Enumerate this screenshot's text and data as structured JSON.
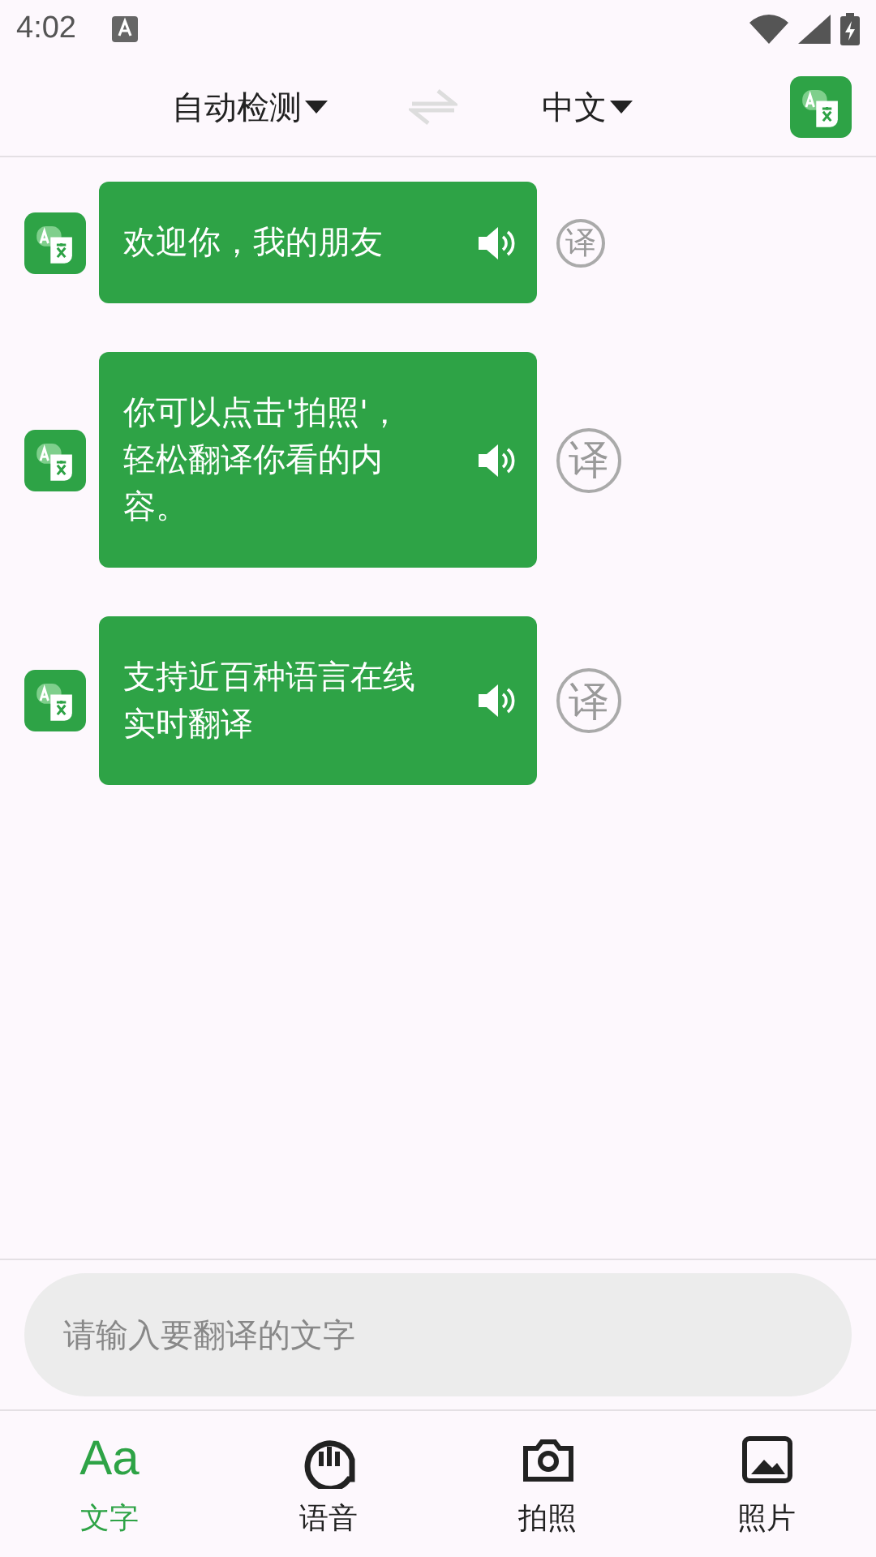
{
  "status_bar": {
    "time": "4:02"
  },
  "header": {
    "source_language": "自动检测",
    "target_language": "中文"
  },
  "messages": [
    {
      "text": "欢迎你，我的朋友",
      "translate_label": "译"
    },
    {
      "text": "你可以点击'拍照'，轻松翻译你看的内容。",
      "translate_label": "译"
    },
    {
      "text": "支持近百种语言在线实时翻译",
      "translate_label": "译"
    }
  ],
  "input": {
    "placeholder": "请输入要翻译的文字"
  },
  "tabs": [
    {
      "kind": "text",
      "label": "文字",
      "icon_text": "Aa",
      "selected": true
    },
    {
      "kind": "voice",
      "label": "语音",
      "selected": false
    },
    {
      "kind": "camera",
      "label": "拍照",
      "selected": false
    },
    {
      "kind": "photo",
      "label": "照片",
      "selected": false
    }
  ]
}
